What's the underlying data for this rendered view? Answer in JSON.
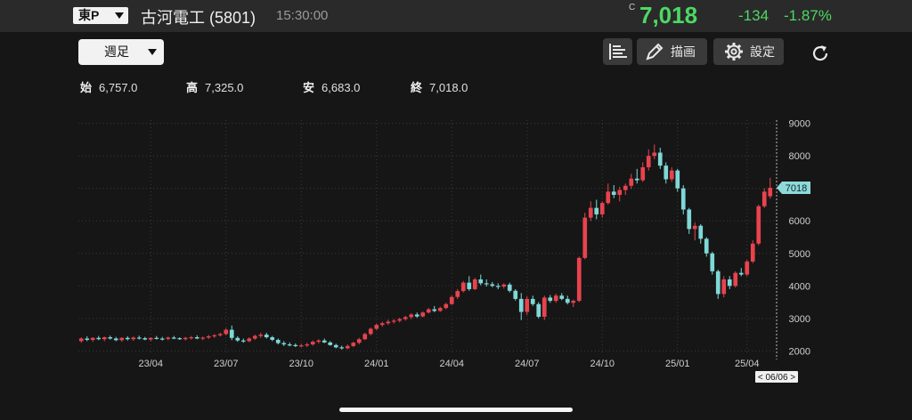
{
  "header": {
    "market": "東P",
    "company": "古河電工 (5801)",
    "time": "15:30:00",
    "price_flag": "C",
    "price": "7,018",
    "change": "-134",
    "change_pct": "-1.87%",
    "colors": {
      "up_text": "#4cd964"
    }
  },
  "toolbar": {
    "period": "週足",
    "draw_label": "描画",
    "settings_label": "設定",
    "icons": [
      "chart-list-icon",
      "pencil-icon",
      "gear-icon",
      "reload-icon"
    ]
  },
  "ohlc": {
    "open_label": "始",
    "open": "6,757.0",
    "high_label": "高",
    "high": "7,325.0",
    "low_label": "安",
    "low": "6,683.0",
    "close_label": "終",
    "close": "7,018.0"
  },
  "chart_data": {
    "type": "candlestick",
    "ylim": [
      1900,
      9100
    ],
    "y_ticks": [
      2000,
      3000,
      4000,
      5000,
      6000,
      7000,
      8000,
      9000
    ],
    "x_ticks": [
      {
        "label": "23/04",
        "index": 12
      },
      {
        "label": "23/07",
        "index": 25
      },
      {
        "label": "23/10",
        "index": 38
      },
      {
        "label": "24/01",
        "index": 51
      },
      {
        "label": "24/04",
        "index": 64
      },
      {
        "label": "24/07",
        "index": 77
      },
      {
        "label": "24/10",
        "index": 90
      },
      {
        "label": "25/01",
        "index": 103
      },
      {
        "label": "25/04",
        "index": 115
      }
    ],
    "last_price_label": "7018",
    "last_price": 7018,
    "date_label": "< 06/06 >",
    "colors": {
      "up": "#e8434e",
      "down": "#7fd8d8",
      "label_bg": "#8fd9d9"
    },
    "candles": [
      [
        2300,
        2420,
        2250,
        2380
      ],
      [
        2380,
        2450,
        2300,
        2340
      ],
      [
        2340,
        2420,
        2280,
        2400
      ],
      [
        2400,
        2460,
        2330,
        2360
      ],
      [
        2360,
        2440,
        2300,
        2420
      ],
      [
        2420,
        2470,
        2350,
        2380
      ],
      [
        2380,
        2430,
        2300,
        2330
      ],
      [
        2330,
        2420,
        2280,
        2400
      ],
      [
        2400,
        2450,
        2320,
        2360
      ],
      [
        2360,
        2440,
        2310,
        2410
      ],
      [
        2410,
        2470,
        2350,
        2390
      ],
      [
        2390,
        2430,
        2330,
        2350
      ],
      [
        2350,
        2420,
        2300,
        2400
      ],
      [
        2400,
        2460,
        2350,
        2380
      ],
      [
        2380,
        2430,
        2320,
        2370
      ],
      [
        2370,
        2440,
        2330,
        2410
      ],
      [
        2410,
        2460,
        2360,
        2390
      ],
      [
        2390,
        2420,
        2340,
        2360
      ],
      [
        2360,
        2430,
        2320,
        2400
      ],
      [
        2400,
        2460,
        2350,
        2420
      ],
      [
        2420,
        2480,
        2360,
        2380
      ],
      [
        2380,
        2440,
        2330,
        2410
      ],
      [
        2410,
        2490,
        2370,
        2450
      ],
      [
        2450,
        2520,
        2400,
        2480
      ],
      [
        2480,
        2560,
        2440,
        2520
      ],
      [
        2520,
        2700,
        2480,
        2650
      ],
      [
        2650,
        2780,
        2330,
        2400
      ],
      [
        2400,
        2450,
        2280,
        2320
      ],
      [
        2320,
        2380,
        2250,
        2300
      ],
      [
        2300,
        2420,
        2270,
        2380
      ],
      [
        2380,
        2500,
        2340,
        2460
      ],
      [
        2460,
        2560,
        2400,
        2500
      ],
      [
        2500,
        2560,
        2380,
        2420
      ],
      [
        2420,
        2460,
        2300,
        2340
      ],
      [
        2340,
        2380,
        2200,
        2240
      ],
      [
        2240,
        2300,
        2150,
        2200
      ],
      [
        2200,
        2260,
        2140,
        2180
      ],
      [
        2180,
        2230,
        2120,
        2160
      ],
      [
        2160,
        2220,
        2110,
        2170
      ],
      [
        2170,
        2250,
        2120,
        2200
      ],
      [
        2200,
        2320,
        2160,
        2280
      ],
      [
        2280,
        2360,
        2230,
        2320
      ],
      [
        2320,
        2380,
        2240,
        2260
      ],
      [
        2260,
        2300,
        2160,
        2180
      ],
      [
        2180,
        2220,
        2080,
        2110
      ],
      [
        2110,
        2160,
        2040,
        2080
      ],
      [
        2080,
        2200,
        2050,
        2150
      ],
      [
        2150,
        2280,
        2120,
        2250
      ],
      [
        2250,
        2400,
        2200,
        2360
      ],
      [
        2360,
        2560,
        2330,
        2520
      ],
      [
        2520,
        2720,
        2480,
        2680
      ],
      [
        2680,
        2840,
        2640,
        2800
      ],
      [
        2800,
        2900,
        2740,
        2850
      ],
      [
        2850,
        2960,
        2800,
        2900
      ],
      [
        2900,
        2980,
        2840,
        2930
      ],
      [
        2930,
        3020,
        2880,
        2980
      ],
      [
        2980,
        3080,
        2930,
        3040
      ],
      [
        3040,
        3160,
        2980,
        3120
      ],
      [
        3120,
        3180,
        3020,
        3060
      ],
      [
        3060,
        3220,
        3030,
        3180
      ],
      [
        3180,
        3320,
        3150,
        3280
      ],
      [
        3280,
        3380,
        3190,
        3230
      ],
      [
        3230,
        3360,
        3200,
        3320
      ],
      [
        3320,
        3480,
        3280,
        3440
      ],
      [
        3440,
        3700,
        3420,
        3660
      ],
      [
        3660,
        3900,
        3600,
        3840
      ],
      [
        3840,
        4150,
        3800,
        4100
      ],
      [
        4100,
        4300,
        3850,
        3900
      ],
      [
        3900,
        4250,
        3870,
        4200
      ],
      [
        4200,
        4350,
        4020,
        4080
      ],
      [
        4080,
        4200,
        3980,
        4050
      ],
      [
        4050,
        4120,
        3960,
        4000
      ],
      [
        4000,
        4080,
        3900,
        3980
      ],
      [
        3980,
        4080,
        3920,
        4040
      ],
      [
        4040,
        4100,
        3800,
        3850
      ],
      [
        3850,
        3900,
        3550,
        3600
      ],
      [
        3600,
        3780,
        2950,
        3200
      ],
      [
        3200,
        3680,
        3100,
        3600
      ],
      [
        3600,
        3700,
        3380,
        3440
      ],
      [
        3440,
        3500,
        3000,
        3050
      ],
      [
        3050,
        3700,
        2950,
        3640
      ],
      [
        3640,
        3720,
        3480,
        3540
      ],
      [
        3540,
        3760,
        3480,
        3700
      ],
      [
        3700,
        3780,
        3560,
        3600
      ],
      [
        3600,
        3700,
        3430,
        3480
      ],
      [
        3480,
        3580,
        3350,
        3540
      ],
      [
        3540,
        4900,
        3500,
        4860
      ],
      [
        4860,
        6250,
        4820,
        6100
      ],
      [
        6100,
        6600,
        6000,
        6400
      ],
      [
        6400,
        6650,
        6050,
        6200
      ],
      [
        6200,
        6600,
        6100,
        6550
      ],
      [
        6550,
        7150,
        6500,
        6900
      ],
      [
        6900,
        7100,
        6700,
        6800
      ],
      [
        6800,
        7050,
        6600,
        6950
      ],
      [
        6950,
        7150,
        6800,
        7080
      ],
      [
        7080,
        7450,
        6980,
        7300
      ],
      [
        7300,
        7600,
        7150,
        7250
      ],
      [
        7250,
        7800,
        7200,
        7650
      ],
      [
        7650,
        8200,
        7550,
        8000
      ],
      [
        8000,
        8350,
        7900,
        8100
      ],
      [
        8100,
        8250,
        7600,
        7700
      ],
      [
        7700,
        7800,
        7150,
        7280
      ],
      [
        7280,
        7650,
        7200,
        7550
      ],
      [
        7550,
        7600,
        6900,
        7000
      ],
      [
        7000,
        7100,
        6200,
        6350
      ],
      [
        6350,
        6400,
        5600,
        5750
      ],
      [
        5750,
        5950,
        5400,
        5850
      ],
      [
        5850,
        5900,
        5300,
        5450
      ],
      [
        5450,
        5500,
        4900,
        5000
      ],
      [
        5000,
        5050,
        4350,
        4450
      ],
      [
        4450,
        4500,
        3600,
        3750
      ],
      [
        3750,
        4300,
        3650,
        4200
      ],
      [
        4200,
        4300,
        3900,
        4000
      ],
      [
        4000,
        4450,
        3950,
        4400
      ],
      [
        4400,
        4550,
        4300,
        4350
      ],
      [
        4350,
        4800,
        4300,
        4750
      ],
      [
        4750,
        5400,
        4700,
        5300
      ],
      [
        5300,
        6500,
        5250,
        6450
      ],
      [
        6450,
        7000,
        6400,
        6900
      ],
      [
        6757,
        7325,
        6683,
        7018
      ]
    ]
  }
}
